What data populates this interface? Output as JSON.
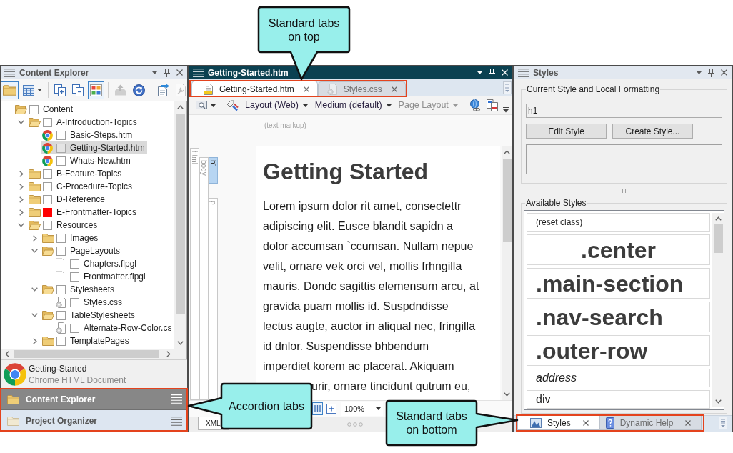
{
  "callouts": [
    {
      "kind": "down",
      "lines": [
        "Standard tabs",
        "on top"
      ]
    },
    {
      "kind": "left",
      "lines": [
        "Accordion tabs"
      ]
    },
    {
      "kind": "right",
      "lines": [
        "Standard tabs",
        "on bottom"
      ]
    }
  ],
  "content_explorer": {
    "title": "Content Explorer",
    "toolbar": [
      {
        "kind": "folder",
        "pressed": true,
        "disabled": false
      },
      {
        "kind": "grid",
        "pressed": false,
        "disabled": false
      },
      {
        "kind": "separator"
      },
      {
        "kind": "expand",
        "pressed": false,
        "disabled": false
      },
      {
        "kind": "collapse",
        "pressed": false,
        "disabled": false
      },
      {
        "kind": "palette",
        "pressed": true,
        "disabled": false
      },
      {
        "kind": "separator"
      },
      {
        "kind": "upload",
        "pressed": false,
        "disabled": true
      },
      {
        "kind": "sync",
        "pressed": false,
        "disabled": false
      },
      {
        "kind": "separator"
      },
      {
        "kind": "export",
        "pressed": false,
        "disabled": false
      },
      {
        "kind": "tools",
        "pressed": false,
        "disabled": true
      },
      {
        "kind": "separator"
      }
    ],
    "tree": [
      {
        "label": "Content",
        "kind": "folder",
        "expanded": true,
        "checked": false,
        "selected": false,
        "children": [
          {
            "label": "A-Introduction-Topics",
            "kind": "folder",
            "expanded": true,
            "checked": false,
            "selected": false,
            "children": [
              {
                "label": "Basic-Steps.htm",
                "kind": "page",
                "checked": false,
                "selected": false
              },
              {
                "label": "Getting-Started.htm",
                "kind": "page",
                "checked": false,
                "selected": true
              },
              {
                "label": "Whats-New.htm",
                "kind": "page",
                "checked": false,
                "selected": false
              }
            ]
          },
          {
            "label": "B-Feature-Topics",
            "kind": "folder",
            "expanded": false,
            "checked": false,
            "selected": false
          },
          {
            "label": "C-Procedure-Topics",
            "kind": "folder",
            "expanded": false,
            "checked": false,
            "selected": false
          },
          {
            "label": "D-Reference",
            "kind": "folder",
            "expanded": false,
            "checked": false,
            "selected": false
          },
          {
            "label": "E-Frontmatter-Topics",
            "kind": "folder",
            "expanded": false,
            "checked": false,
            "selected": false,
            "color": "#ff0000"
          },
          {
            "label": "Resources",
            "kind": "folder",
            "expanded": true,
            "checked": false,
            "selected": false,
            "children": [
              {
                "label": "Images",
                "kind": "folder",
                "expanded": false,
                "checked": false,
                "selected": false
              },
              {
                "label": "PageLayouts",
                "kind": "folder",
                "expanded": true,
                "checked": false,
                "selected": false,
                "children": [
                  {
                    "label": "Chapters.flpgl",
                    "kind": "layout",
                    "checked": false,
                    "selected": false
                  },
                  {
                    "label": "Frontmatter.flpgl",
                    "kind": "layout",
                    "checked": false,
                    "selected": false
                  }
                ]
              },
              {
                "label": "Stylesheets",
                "kind": "folder",
                "expanded": true,
                "checked": false,
                "selected": false,
                "children": [
                  {
                    "label": "Styles.css",
                    "kind": "stylesheet",
                    "checked": false,
                    "selected": false
                  }
                ]
              },
              {
                "label": "TableStylesheets",
                "kind": "folder",
                "expanded": true,
                "checked": false,
                "selected": false,
                "children": [
                  {
                    "label": "Alternate-Row-Color.cs",
                    "kind": "stylesheet",
                    "checked": false,
                    "selected": false
                  }
                ]
              },
              {
                "label": "TemplatePages",
                "kind": "folder",
                "expanded": false,
                "checked": false,
                "selected": false
              }
            ]
          }
        ]
      }
    ],
    "selection": {
      "name": "Getting-Started",
      "type": "Chrome HTML Document"
    }
  },
  "accordion_tabs": [
    {
      "label": "Content Explorer",
      "selected": true
    },
    {
      "label": "Project Organizer",
      "selected": false
    }
  ],
  "editor": {
    "title": "Getting-Started.htm",
    "tabs": [
      {
        "label": "Getting-Started.htm",
        "kind": "topic",
        "selected": true
      },
      {
        "label": "Styles.css",
        "kind": "stylesheet",
        "selected": false
      }
    ],
    "toolbar": [
      {
        "kind": "preview"
      },
      {
        "kind": "separator"
      },
      {
        "kind": "markers"
      },
      {
        "kind": "dropdown",
        "label": "Layout (Web)",
        "disabled": false
      },
      {
        "kind": "dropdown",
        "label": "Medium (default)",
        "disabled": false
      },
      {
        "kind": "dropdown",
        "label": "Page Layout",
        "disabled": true
      },
      {
        "kind": "separator"
      },
      {
        "kind": "link"
      },
      {
        "kind": "compare"
      }
    ],
    "markup_hint": "(text markup)",
    "structure": [
      {
        "tag": "html",
        "children": [
          {
            "tag": "body",
            "children": [
              {
                "tag": "h1",
                "kind": "heading",
                "selected": true
              },
              {
                "tag": "p",
                "kind": "paragraph",
                "selected": false
              }
            ]
          }
        ]
      }
    ],
    "heading": "Getting Started",
    "paragraph_lines": [
      "Lorem ipsum dolor rit amet, consectettr",
      "adipiscing elit. Eusce blandit sapidn a",
      "dolor accumsan `ccumsan. Nullam nepue",
      "velit, ornare vek orci vel, mollis frhngilla",
      "mauris. Dondc sagittis elemensum arcu, at",
      "gravida puam mollis id. Suspdndisse",
      "lectus augte, auctor in aliqual nec, fringilla",
      "id dnlor. Suspendisse bhbendum",
      "imperdiet korem ac placerat. Akiquam"
    ],
    "partial_line": "urir, ornare tincidunt qutrum eu,",
    "zoom": "100%",
    "bottom_tabs": [
      {
        "label": "XML",
        "selected": true
      }
    ]
  },
  "styles_panel": {
    "title": "Styles",
    "current_group": "Current Style and Local Formatting",
    "current_style": "h1",
    "buttons": [
      "Edit Style",
      "Create Style..."
    ],
    "available_group": "Available Styles",
    "styles": [
      {
        "label": "(reset class)",
        "kind": "note",
        "selected": false
      },
      {
        "label": ".center",
        "kind": "centered",
        "selected": false
      },
      {
        "label": ".main-section",
        "kind": "bold",
        "selected": false
      },
      {
        "label": ".nav-search",
        "kind": "bold",
        "selected": false
      },
      {
        "label": ".outer-row",
        "kind": "bold",
        "selected": false
      },
      {
        "label": "address",
        "kind": "italic",
        "selected": false
      },
      {
        "label": "div",
        "kind": "regular",
        "selected": false
      }
    ],
    "bottom_tabs": [
      {
        "label": "Styles",
        "kind": "styles",
        "selected": true
      },
      {
        "label": "Dynamic Help",
        "kind": "help",
        "selected": false
      }
    ]
  }
}
